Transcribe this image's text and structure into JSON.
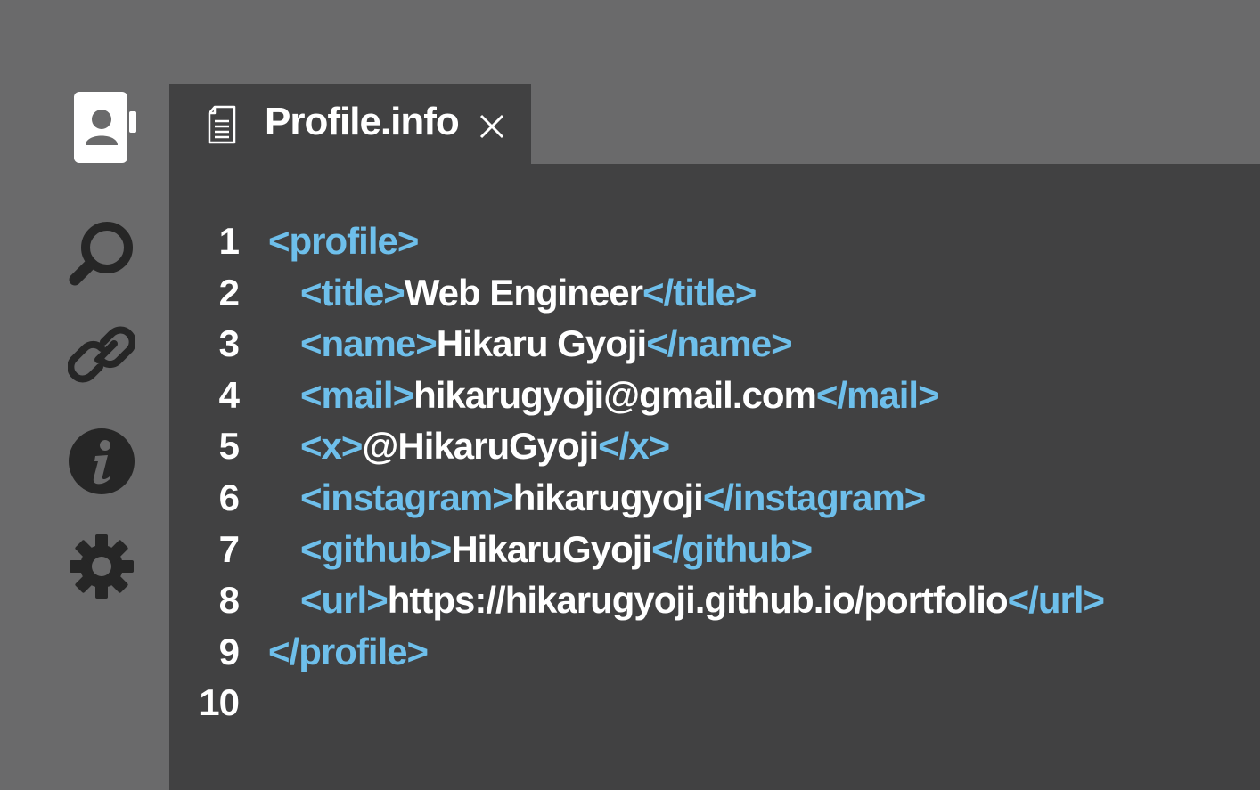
{
  "sidebar": {
    "icons": [
      "profile-card-icon",
      "search-icon",
      "link-icon",
      "info-icon",
      "gear-icon"
    ],
    "icon_color": "#262626",
    "active_icon_color": "#ffffff"
  },
  "tab": {
    "icon": "document-icon",
    "title": "Profile.info",
    "close_icon": "close-icon"
  },
  "colors": {
    "background": "#6a6a6b",
    "editor": "#414142",
    "tag": "#6ebfeb",
    "text": "#ffffff"
  },
  "editor": {
    "lines": [
      {
        "number": "1",
        "open_tag": "<profile>",
        "value": "",
        "close_tag": ""
      },
      {
        "number": "2",
        "open_tag": "<title>",
        "value": "Web Engineer",
        "close_tag": "</title>"
      },
      {
        "number": "3",
        "open_tag": "<name>",
        "value": "Hikaru Gyoji",
        "close_tag": "</name>"
      },
      {
        "number": "4",
        "open_tag": "<mail>",
        "value": "hikarugyoji@gmail.com",
        "close_tag": "</mail>"
      },
      {
        "number": "5",
        "open_tag": "<x>",
        "value": "@HikaruGyoji",
        "close_tag": "</x>"
      },
      {
        "number": "6",
        "open_tag": "<instagram>",
        "value": "hikarugyoji",
        "close_tag": "</instagram>"
      },
      {
        "number": "7",
        "open_tag": "<github>",
        "value": "HikaruGyoji",
        "close_tag": "</github>"
      },
      {
        "number": "8",
        "open_tag": "<url>",
        "value": "https://hikarugyoji.github.io/portfolio",
        "close_tag": "</url>"
      },
      {
        "number": "9",
        "open_tag": "</profile>",
        "value": "",
        "close_tag": ""
      },
      {
        "number": "10",
        "open_tag": "",
        "value": "",
        "close_tag": ""
      }
    ]
  }
}
